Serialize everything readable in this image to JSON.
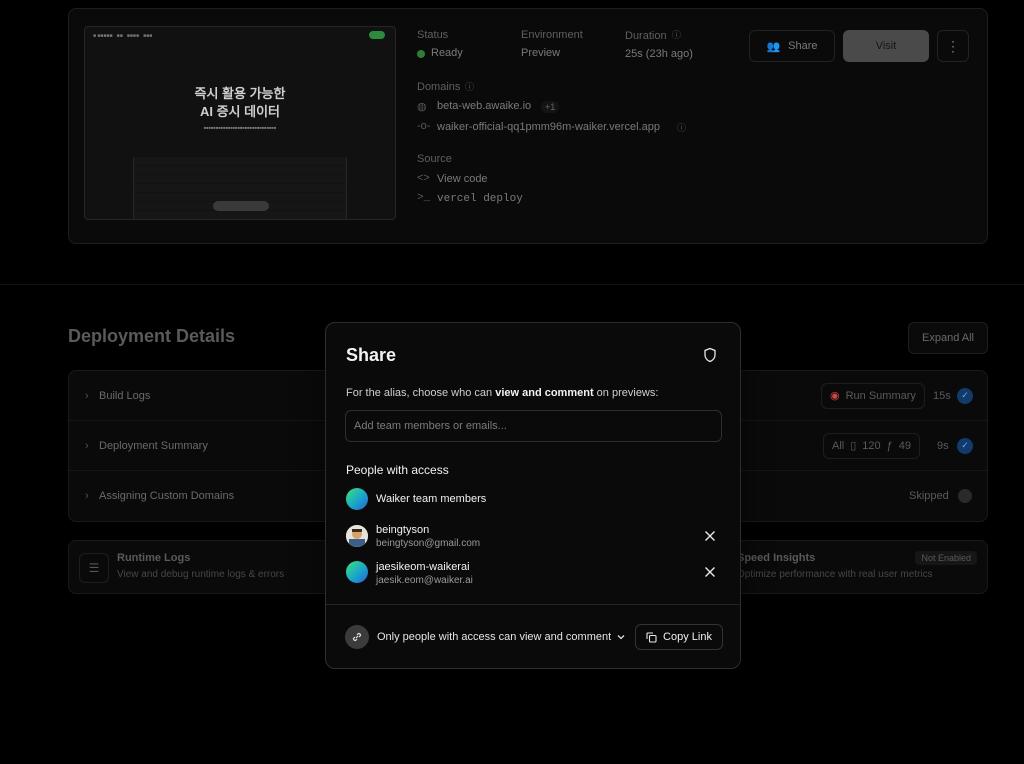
{
  "deployment": {
    "status_label": "Status",
    "status_value": "Ready",
    "env_label": "Environment",
    "env_value": "Preview",
    "duration_label": "Duration",
    "duration_value": "25s (23h ago)",
    "domains_label": "Domains",
    "domain_primary": "beta-web.awaike.io",
    "domain_extra": "+1",
    "domain_secondary": "waiker-official-qq1pmm96m-waiker.vercel.app",
    "source_label": "Source",
    "view_code": "View code",
    "cli": "vercel deploy",
    "share_label": "Share",
    "visit_label": "Visit",
    "preview_heading_1": "즉시 활용 가능한",
    "preview_heading_2": "AI 증시 데이터"
  },
  "details": {
    "title": "Deployment Details",
    "expand_all": "Expand All",
    "rows": [
      {
        "label": "Build Logs",
        "pill": "Run Summary",
        "time": "15s"
      },
      {
        "label": "Deployment Summary",
        "pill_all": "All",
        "pill_files": "120",
        "pill_fn": "49",
        "time": "9s"
      },
      {
        "label": "Assigning Custom Domains",
        "status": "Skipped"
      }
    ]
  },
  "bottom": {
    "runtime_title": "Runtime Logs",
    "runtime_sub": "View and debug runtime logs & errors",
    "speed_title": "Speed Insights",
    "speed_sub": "Optimize performance with real user metrics",
    "speed_badge": "Not Enabled"
  },
  "modal": {
    "title": "Share",
    "desc_pre": "For the alias, choose who can ",
    "desc_bold": "view and comment",
    "desc_post": " on previews:",
    "input_placeholder": "Add team members or emails...",
    "people_heading": "People with access",
    "team_name": "Waiker team members",
    "users": [
      {
        "name": "beingtyson",
        "email": "beingtyson@gmail.com"
      },
      {
        "name": "jaesikeom-waikerai",
        "email": "jaesik.eom@waiker.ai"
      }
    ],
    "permission": "Only people with access can view and comment",
    "copy_link": "Copy Link"
  },
  "colors": {
    "ready": "#2e7d3a",
    "check": "#1f6feb"
  }
}
